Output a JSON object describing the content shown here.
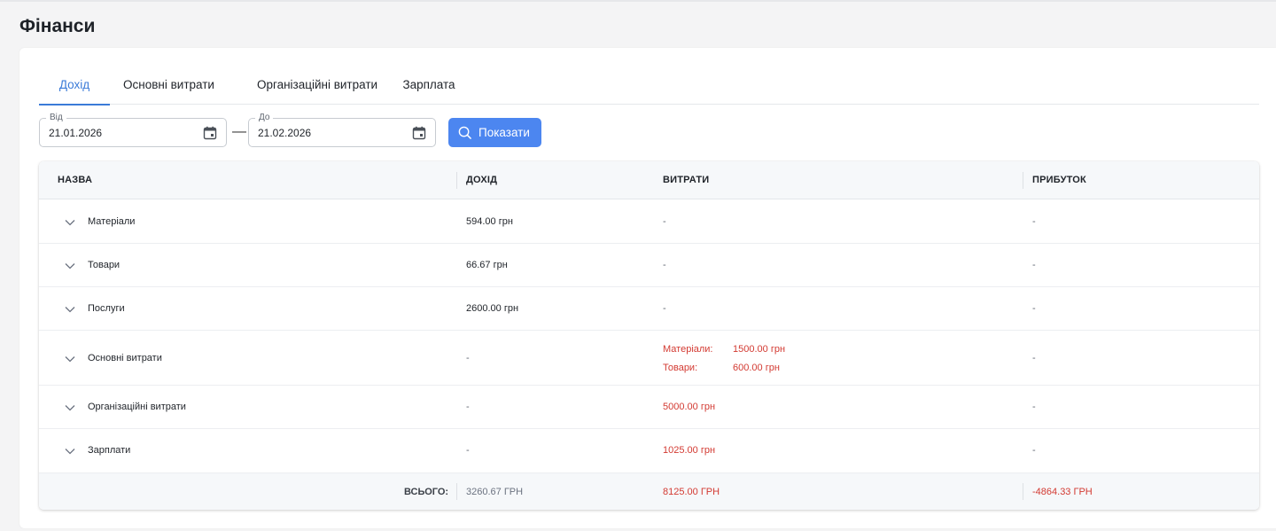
{
  "page": {
    "title": "Фінанси"
  },
  "tabs": [
    {
      "label": "Дохід",
      "active": true
    },
    {
      "label": "Основні витрати",
      "active": false
    },
    {
      "label": "Організаційні витрати",
      "active": false
    },
    {
      "label": "Зарплата",
      "active": false
    }
  ],
  "filters": {
    "from": {
      "label": "Від",
      "value": "21.01.2026",
      "icon": "calendar-icon"
    },
    "separator": "—",
    "to": {
      "label": "До",
      "value": "21.02.2026",
      "icon": "calendar-icon"
    },
    "show_button": {
      "label": "Показати",
      "icon": "search-icon"
    }
  },
  "table": {
    "headers": {
      "name": "НАЗВА",
      "income": "ДОХІД",
      "expenses": "ВИТРАТИ",
      "profit": "ПРИБУТОК"
    },
    "rows": [
      {
        "name": "Матеріали",
        "income": "594.00 грн",
        "expenses": "-",
        "profit": "-"
      },
      {
        "name": "Товари",
        "income": "66.67 грн",
        "expenses": "-",
        "profit": "-"
      },
      {
        "name": "Послуги",
        "income": "2600.00 грн",
        "expenses": "-",
        "profit": "-"
      },
      {
        "name": "Основні витрати",
        "income": "-",
        "expenses_breakdown": [
          {
            "label": "Матеріали:",
            "value": "1500.00 грн"
          },
          {
            "label": "Товари:",
            "value": "600.00 грн"
          }
        ],
        "profit": "-"
      },
      {
        "name": "Організаційні витрати",
        "income": "-",
        "expenses": "5000.00 грн",
        "profit": "-"
      },
      {
        "name": "Зарплати",
        "income": "-",
        "expenses": "1025.00 грн",
        "profit": "-"
      }
    ],
    "totals": {
      "label": "ВСЬОГО:",
      "income": "3260.67 ГРН",
      "expenses": "8125.00 ГРН",
      "profit": "-4864.33 ГРН"
    }
  },
  "colors": {
    "accent": "#4c86f0",
    "tab_active": "#3b7bd8",
    "negative": "#d33a32"
  }
}
